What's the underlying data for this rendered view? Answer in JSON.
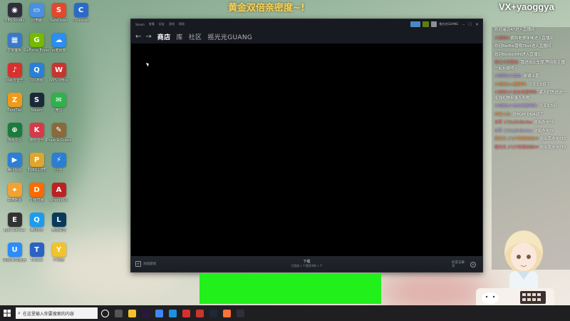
{
  "overlay": {
    "banner": "黄金双倍亲密度~!",
    "watermark": "VX+yaoggya"
  },
  "desktop_icons": [
    {
      "label": "OBS Studio",
      "color": "#302e3a",
      "glyph": "◉"
    },
    {
      "label": "控制面板",
      "color": "#3a79c9",
      "glyph": "▦"
    },
    {
      "label": "网易云音乐",
      "color": "#d8302f",
      "glyph": "♪"
    },
    {
      "label": "ZeroTier",
      "color": "#f09a1c",
      "glyph": "Z"
    },
    {
      "label": "游戏平台",
      "color": "#1c7b3c",
      "glyph": "⊕"
    },
    {
      "label": "腾讯视频",
      "color": "#2d7ed6",
      "glyph": "▶"
    },
    {
      "label": "高德地图",
      "color": "#f2a230",
      "glyph": "⌖"
    },
    {
      "label": "Epic Games",
      "color": "#333",
      "glyph": "E"
    },
    {
      "label": "网易UU加速器",
      "color": "#2a8cff",
      "glyph": "U"
    },
    {
      "label": "此电脑",
      "color": "#4a90e2",
      "glyph": "▭"
    },
    {
      "label": "GeForce Experience",
      "color": "#76b900",
      "glyph": "G"
    },
    {
      "label": "QQ游戏",
      "color": "#2a7fd6",
      "glyph": "Q"
    },
    {
      "label": "Steam",
      "color": "#1b2838",
      "glyph": "S"
    },
    {
      "label": "酷狗音乐",
      "color": "#d8394a",
      "glyph": "K"
    },
    {
      "label": "PUBG LITE",
      "color": "#e0a52c",
      "glyph": "P"
    },
    {
      "label": "斗鱼直播",
      "color": "#ff6a00",
      "glyph": "D"
    },
    {
      "label": "腾讯QQ",
      "color": "#1a9cf0",
      "glyph": "Q"
    },
    {
      "label": "TCloud",
      "color": "#2a62c5",
      "glyph": "T"
    },
    {
      "label": "SafeDown",
      "color": "#e2482d",
      "glyph": "S"
    },
    {
      "label": "百度网盘",
      "color": "#2b8ef0",
      "glyph": "☁"
    },
    {
      "label": "WPS Office",
      "color": "#c7352f",
      "glyph": "W"
    },
    {
      "label": "微信",
      "color": "#2fb24b",
      "glyph": "✉"
    },
    {
      "label": "Draw & Guess",
      "color": "#8a6a3c",
      "glyph": "✎"
    },
    {
      "label": "迅雷",
      "color": "#2a7ed6",
      "glyph": "⚡"
    },
    {
      "label": "Among Us",
      "color": "#b22",
      "glyph": "A"
    },
    {
      "label": "英雄联盟",
      "color": "#0a3a5a",
      "glyph": "L"
    },
    {
      "label": "YY语音",
      "color": "#f2c32a",
      "glyph": "Y"
    },
    {
      "label": "CCleaner",
      "color": "#2d6ac7",
      "glyph": "C"
    }
  ],
  "steam": {
    "menu_items": [
      "Steam",
      "查看",
      "好友",
      "游戏",
      "帮助"
    ],
    "account_label": "摇光光GUANG",
    "tabs": [
      "商店",
      "库",
      "社区",
      "摇光光GUANG"
    ],
    "active_tab_index": 0,
    "add_game_label": "添加游戏",
    "download_title": "下载",
    "download_status": "已完成 1 个项目中的 1 个",
    "friends_label": "好友与聊天"
  },
  "chat": {
    "messages": [
      {
        "user": "",
        "text": "欢迎遥远47进入直播间"
      },
      {
        "user": "小丽饭♀",
        "text": "摘欢老婆咪咪进入直播间"
      },
      {
        "user": "",
        "text": "欢迎BeiBei蕾鸭Ther进入直播间"
      },
      {
        "user": "",
        "text": "欢迎BinRinHHi进入直播间"
      },
      {
        "user": "摇光光的歌迷:",
        "text": "我进出上车厚,等待和主播一起玩游戏~"
      },
      {
        "user": "小丽饭♀小龙女:",
        "text": "谢谢上香"
      },
      {
        "user": "小丽饭♀ne酸辣鸡:",
        "text": "今天1.5倍了"
      },
      {
        "user": "小丽饭♀小龙女老婆咪咪:",
        "text": "家人们先送这一毛钱礼物来凑人头哦"
      },
      {
        "user": "小丽饭♀小龙女老婆咪咪:",
        "text": "今天1.5倍"
      },
      {
        "user": "京宝儿北:",
        "text": "这BGM DNA动了"
      },
      {
        "user": "冰军 17|YuZhiBoYao",
        "text": "送出办卡*2"
      },
      {
        "user": "冰军 17|YuZhiBoYao",
        "text": "送出办卡*2"
      },
      {
        "user": "摇光光 27|只有摇如画00",
        "text": "送出草办卡*10"
      },
      {
        "user": "摇光光 27|只有摇如画00",
        "text": "送出草办卡*10"
      }
    ]
  },
  "taskbar": {
    "search_placeholder": "在这里输入你要搜索的内容",
    "apps": [
      "task-view",
      "file-explorer",
      "adobe-premiere",
      "chrome",
      "edge",
      "netease-music",
      "wps",
      "steam",
      "firefox",
      "obs"
    ]
  }
}
